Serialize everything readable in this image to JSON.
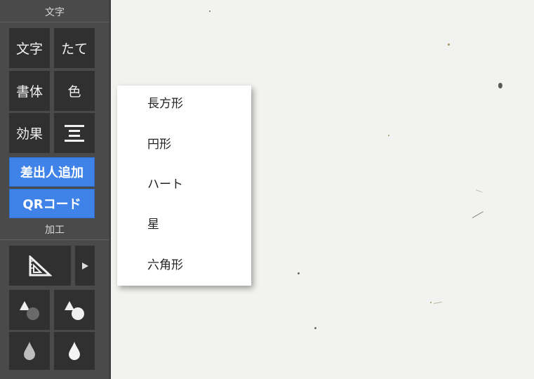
{
  "sidebar": {
    "text_section_title": "文字",
    "text_tiles": {
      "text": "文字",
      "vertical": "たて",
      "font": "書体",
      "color": "色",
      "effect": "効果",
      "align_icon": "align-center-icon"
    },
    "mailmerge_button": "差出人追加",
    "qr_button": "QRコード",
    "process_section_title": "加工",
    "process_tiles": {
      "shape_icon": "set-square-icon",
      "expand_icon": "play-arrow-icon",
      "shape_dark_icon": "shapes-dark-icon",
      "shape_light_icon": "shapes-light-icon",
      "drop_light_icon": "drop-light-icon",
      "drop_white_icon": "drop-white-icon"
    }
  },
  "shape_menu": {
    "items": [
      "長方形",
      "円形",
      "ハート",
      "星",
      "六角形"
    ]
  },
  "colors": {
    "sidebar_bg": "#4a4a4a",
    "tile_bg": "#303030",
    "accent_blue": "#3f83e8",
    "paper": "#f2f2f0"
  }
}
